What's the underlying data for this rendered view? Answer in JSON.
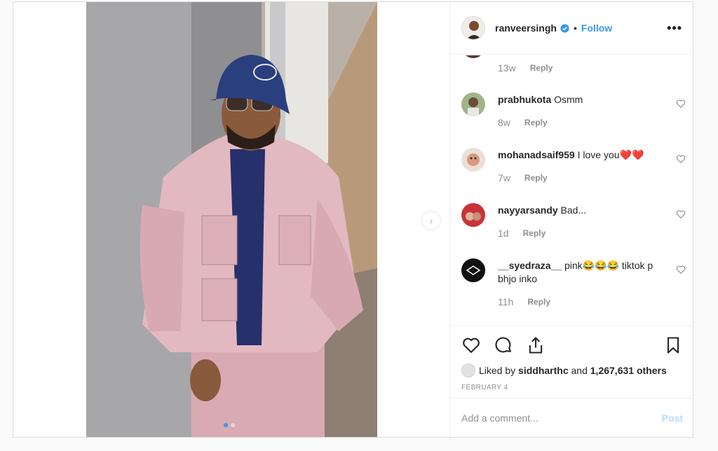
{
  "header": {
    "username": "ranveersingh",
    "separator": "•",
    "follow_label": "Follow",
    "more_label": "•••"
  },
  "comments": [
    {
      "user": "",
      "text": "",
      "age": "13w",
      "reply": "Reply"
    },
    {
      "user": "prabhukota",
      "text": "Osmm",
      "age": "8w",
      "reply": "Reply"
    },
    {
      "user": "mohanadsaif959",
      "text": "I love you❤️❤️",
      "age": "7w",
      "reply": "Reply"
    },
    {
      "user": "nayyarsandy",
      "text": "Bad...",
      "age": "1d",
      "reply": "Reply"
    },
    {
      "user": "__syedraza__",
      "text": "pink😂😂😂 tiktok p bhjo inko",
      "age": "11h",
      "reply": "Reply"
    }
  ],
  "likes": {
    "prefix": "Liked by",
    "user": "siddharthc",
    "middle": "and",
    "count": "1,267,631 others"
  },
  "date": "February 4",
  "add_comment": {
    "placeholder": "Add a comment...",
    "post_label": "Post"
  },
  "colors": {
    "accent": "#3897f0",
    "post_disabled": "#b2dffc",
    "jacket": "#e2b9c0",
    "hat": "#2a3f7d"
  },
  "media": {
    "carousel_count": 2,
    "active_index": 0
  }
}
